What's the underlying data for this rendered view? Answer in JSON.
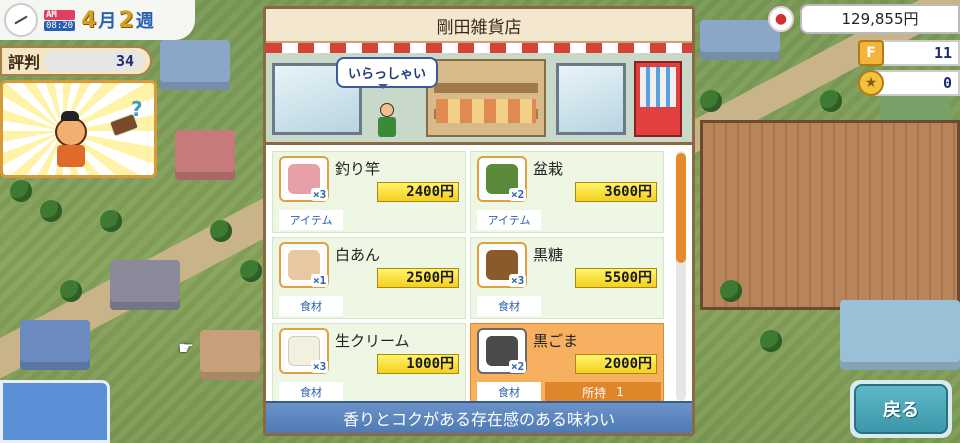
{
  "hud": {
    "ampm": "AM",
    "clock": "08:20",
    "month": "4",
    "month_unit": "月",
    "week": "2",
    "week_unit": "週",
    "reputation_label": "評判",
    "reputation_value": "34",
    "money": "129,855円",
    "f_badge": "F",
    "f_value": "11",
    "coin_value": "0"
  },
  "shop": {
    "title": "剛田雑貨店",
    "greeting": "いらっしゃい",
    "items": [
      {
        "name": "釣り竿",
        "qty": "×3",
        "price": "2400円",
        "category": "アイテム",
        "icon": "fishing-rod-icon",
        "color": "#e8a0a8"
      },
      {
        "name": "盆栽",
        "qty": "×2",
        "price": "3600円",
        "category": "アイテム",
        "icon": "bonsai-icon",
        "color": "#5a8a3a"
      },
      {
        "name": "白あん",
        "qty": "×1",
        "price": "2500円",
        "category": "食材",
        "icon": "white-bean-paste-icon",
        "color": "#e8c8a0"
      },
      {
        "name": "黒糖",
        "qty": "×3",
        "price": "5500円",
        "category": "食材",
        "icon": "brown-sugar-icon",
        "color": "#8a5a2a"
      },
      {
        "name": "生クリーム",
        "qty": "×3",
        "price": "1000円",
        "category": "食材",
        "icon": "fresh-cream-icon",
        "color": "#f4f0e0"
      },
      {
        "name": "黒ごま",
        "qty": "×2",
        "price": "2000円",
        "category": "食材",
        "icon": "black-sesame-icon",
        "color": "#4a4a4a",
        "owned_label": "所持",
        "owned_value": "1"
      }
    ],
    "description": "香りとコクがある存在感のある味わい"
  },
  "back_button": "戻る",
  "colors": {
    "accent": "#e58a2a",
    "selected": "#f6b060",
    "item_bg": "#eef7e4",
    "desc_bg": "#5a84bc"
  }
}
